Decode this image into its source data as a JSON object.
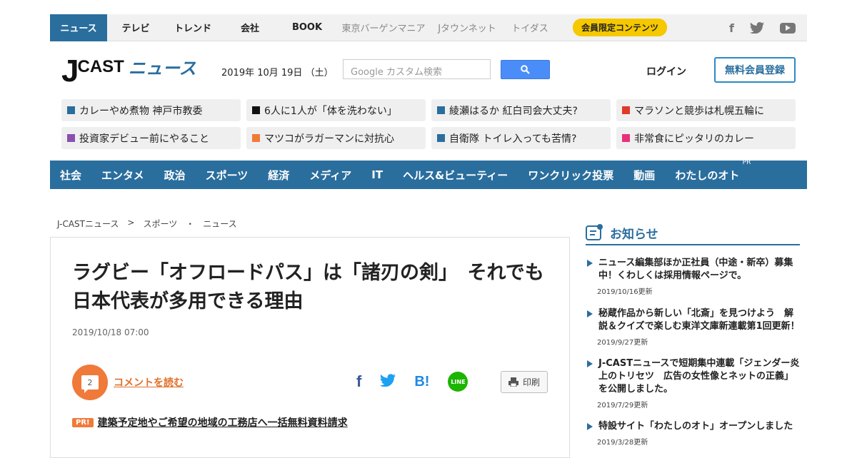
{
  "topnav": {
    "items": [
      {
        "label": "ニュース"
      },
      {
        "label": "テレビ"
      },
      {
        "label": "トレンド"
      },
      {
        "label": "会社"
      },
      {
        "label": "BOOK"
      },
      {
        "label": "東京バーゲンマニア"
      },
      {
        "label": "Jタウンネット"
      },
      {
        "label": "トイダス"
      }
    ],
    "member_label": "会員限定コンテンツ"
  },
  "header": {
    "logo_j": "J",
    "logo_cast": "CAST",
    "logo_news": "ニュース",
    "date": "2019年 10月 19日 （土）",
    "search_placeholder": "Google カスタム検索",
    "login_label": "ログイン",
    "register_label": "無料会員登録"
  },
  "trends": [
    {
      "text": "カレーやめ煮物 神戸市教委",
      "color": "#2a6e9e"
    },
    {
      "text": "6人に1人が「体を洗わない」",
      "color": "#111111"
    },
    {
      "text": "綾瀬はるか 紅白司会大丈夫?",
      "color": "#2a6e9e"
    },
    {
      "text": "マラソンと競歩は札幌五輪に",
      "color": "#e03a2a"
    },
    {
      "text": "投資家デビュー前にやること",
      "color": "#8a4fb0"
    },
    {
      "text": "マツコがラガーマンに対抗心",
      "color": "#f07a3a"
    },
    {
      "text": "自衛隊 トイレ入っても苦情?",
      "color": "#2a6e9e"
    },
    {
      "text": "非常食にピッタリのカレー",
      "color": "#e8307a"
    }
  ],
  "categories": [
    "社会",
    "エンタメ",
    "政治",
    "スポーツ",
    "経済",
    "メディア",
    "IT",
    "ヘルス&ビューティー",
    "ワンクリック投票",
    "動画",
    "わたしのオト"
  ],
  "pr_tag": "PR",
  "breadcrumb": [
    "J-CASTニュース",
    ">",
    "スポーツ",
    "・",
    "ニュース"
  ],
  "article": {
    "title": "ラグビー「オフロードパス」は「諸刃の剣」　それでも日本代表が多用できる理由",
    "date": "2019/10/18 07:00",
    "comment_count": "2",
    "comment_link": "コメントを読む",
    "print_label": "印刷",
    "pr_badge": "PR!",
    "pr_link": "建築予定地やご希望の地域の工務店へ一括無料資料請求"
  },
  "share": {
    "fb": "f",
    "hatena": "B!",
    "line": "LINE"
  },
  "sidebar": {
    "heading": "お知らせ",
    "notices": [
      {
        "title": "ニュース編集部ほか正社員（中途・新卒）募集中！くわしくは採用情報ページで。",
        "date": "2019/10/16更新"
      },
      {
        "title": "秘蔵作品から新しい「北斎」を見つけよう　解説＆クイズで楽しむ東洋文庫新連載第1回更新！",
        "date": "2019/9/27更新"
      },
      {
        "title": "J-CASTニュースで短期集中連載「ジェンダー炎上のトリセツ　広告の女性像とネットの正義」を公開しました。",
        "date": "2019/7/29更新"
      },
      {
        "title": "特設サイト「わたしのオト」オープンしました",
        "date": "2019/3/28更新"
      }
    ]
  }
}
